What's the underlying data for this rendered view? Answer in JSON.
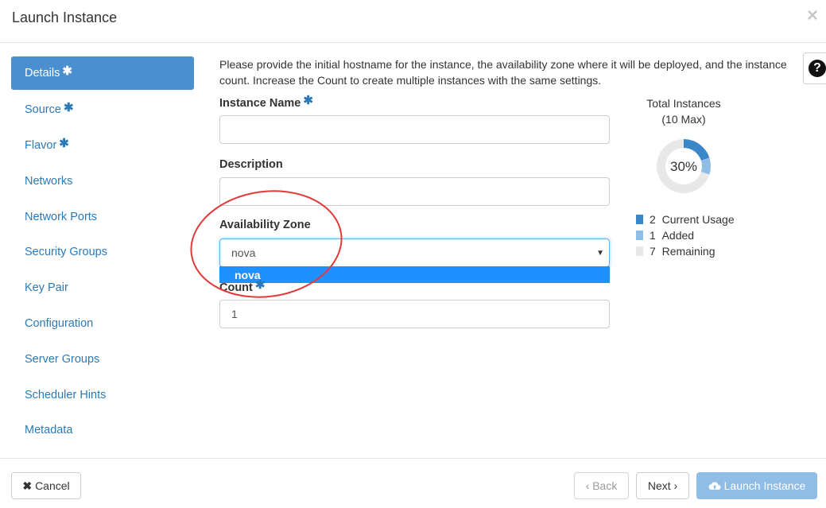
{
  "modal": {
    "title": "Launch Instance",
    "close_icon": "×"
  },
  "sidebar": {
    "items": [
      {
        "label": "Details",
        "required": true,
        "active": true
      },
      {
        "label": "Source",
        "required": true
      },
      {
        "label": "Flavor",
        "required": true
      },
      {
        "label": "Networks"
      },
      {
        "label": "Network Ports"
      },
      {
        "label": "Security Groups"
      },
      {
        "label": "Key Pair"
      },
      {
        "label": "Configuration"
      },
      {
        "label": "Server Groups"
      },
      {
        "label": "Scheduler Hints"
      },
      {
        "label": "Metadata"
      }
    ],
    "required_marker": "✱"
  },
  "details": {
    "help_text": "Please provide the initial hostname for the instance, the availability zone where it will be deployed, and the instance count. Increase the Count to create multiple instances with the same settings.",
    "help_icon": "?",
    "instance_name": {
      "label": "Instance Name",
      "value": ""
    },
    "description": {
      "label": "Description",
      "value": ""
    },
    "availability_zone": {
      "label": "Availability Zone",
      "value": "nova",
      "options": [
        "nova"
      ],
      "highlighted_option": "nova"
    },
    "count": {
      "label": "Count",
      "value": "1"
    }
  },
  "usage": {
    "title": "Total Instances",
    "max": "(10 Max)",
    "percent_label": "30%",
    "current": 2,
    "added": 1,
    "remaining": 7,
    "legend": [
      {
        "count": "2",
        "label": "Current Usage",
        "color": "#3a87c8"
      },
      {
        "count": "1",
        "label": "Added",
        "color": "#8fbde6"
      },
      {
        "count": "7",
        "label": "Remaining",
        "color": "#e8e8e8"
      }
    ]
  },
  "footer": {
    "cancel_label": "Cancel",
    "cancel_icon": "✖",
    "back_label": "‹ Back",
    "next_label": "Next ›",
    "launch_label": "Launch Instance",
    "launch_icon": "cloud-upload-icon"
  },
  "colors": {
    "accent": "#4a8fd0",
    "link": "#2a7ab8",
    "annotation": "#e03a3a",
    "dropdown_highlight": "#1e90ff"
  }
}
